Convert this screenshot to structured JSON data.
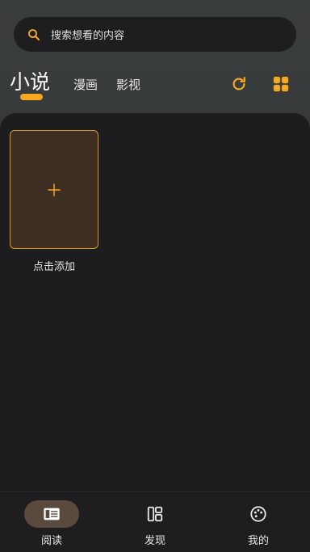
{
  "search": {
    "placeholder": "搜索想看的内容",
    "icon": "search-icon"
  },
  "tabs": [
    {
      "label": "小说",
      "active": true
    },
    {
      "label": "漫画",
      "active": false
    },
    {
      "label": "影视",
      "active": false
    }
  ],
  "toolbar": {
    "refresh_icon": "refresh-icon",
    "layout_icon": "grid-icon"
  },
  "library": {
    "add_label": "点击添加",
    "add_icon": "plus-icon"
  },
  "bottom_nav": [
    {
      "label": "阅读",
      "icon": "book-icon",
      "active": true
    },
    {
      "label": "发现",
      "icon": "layout-icon",
      "active": false
    },
    {
      "label": "我的",
      "icon": "palette-icon",
      "active": false
    }
  ],
  "colors": {
    "accent": "#f5a623",
    "background": "#1d1d20",
    "card": "#3d2f22",
    "nav_active": "#5a4a3e"
  }
}
